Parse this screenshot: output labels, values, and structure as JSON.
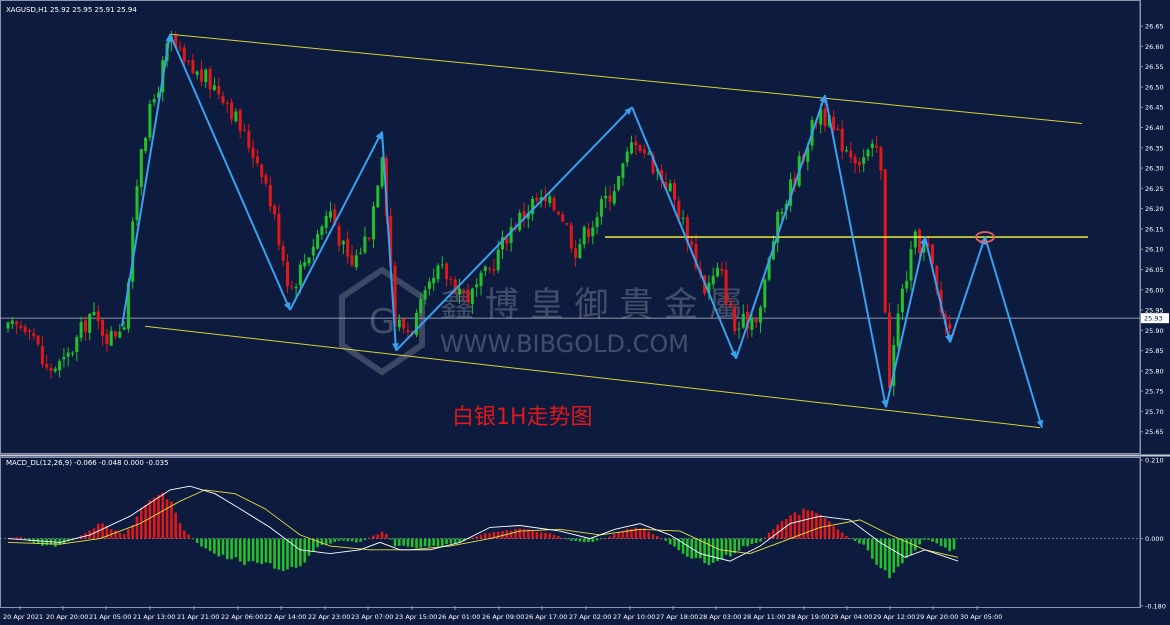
{
  "header": {
    "symbol_info": "XAGUSD,H1  25.92 25.95 25.91 25.94",
    "macd_info": "MACD_DL(12,26,9) -0.066 -0.048 0.000 -0.035"
  },
  "annotation": "白银1H走势图",
  "watermark": {
    "cn": "鑫 博 皇 御 貴 金 屬",
    "en": "WWW.BIBGOLD.COM",
    "logo": "G"
  },
  "colors": {
    "background": "#0d1b3e",
    "bull": "#22c02a",
    "bear": "#e01818",
    "zigzag": "#3aa0f0",
    "channel": "#d8d23a",
    "resistance": "#ffff30",
    "macd_line": "#ffffff",
    "signal_line": "#e8e040"
  },
  "chart_data": [
    {
      "type": "candlestick",
      "symbol": "XAGUSD",
      "timeframe": "H1",
      "ylim": [
        25.6,
        26.67
      ],
      "yticks": [
        "26.65",
        "26.60",
        "26.55",
        "26.50",
        "26.45",
        "26.40",
        "26.35",
        "26.30",
        "26.25",
        "26.20",
        "26.15",
        "26.10",
        "26.05",
        "26.00",
        "25.95",
        "25.90",
        "25.85",
        "25.80",
        "25.75",
        "25.70",
        "25.65"
      ],
      "current_price": "25.93",
      "current_price_value": 25.93,
      "xlim": [
        0,
        1140
      ],
      "xticks": [
        {
          "x": 20,
          "label": "20 Apr 2021"
        },
        {
          "x": 63,
          "label": "20 Apr 20:00"
        },
        {
          "x": 106,
          "label": "21 Apr 05:00"
        },
        {
          "x": 150,
          "label": "21 Apr 13:00"
        },
        {
          "x": 194,
          "label": "21 Apr 21:00"
        },
        {
          "x": 238,
          "label": "22 Apr 06:00"
        },
        {
          "x": 281,
          "label": "22 Apr 14:00"
        },
        {
          "x": 325,
          "label": "22 Apr 23:00"
        },
        {
          "x": 368,
          "label": "23 Apr 07:00"
        },
        {
          "x": 412,
          "label": "23 Apr 15:00"
        },
        {
          "x": 455,
          "label": "26 Apr 01:00"
        },
        {
          "x": 499,
          "label": "26 Apr 09:00"
        },
        {
          "x": 542,
          "label": "26 Apr 17:00"
        },
        {
          "x": 586,
          "label": "27 Apr 02:00"
        },
        {
          "x": 630,
          "label": "27 Apr 10:00"
        },
        {
          "x": 673,
          "label": "27 Apr 18:00"
        },
        {
          "x": 716,
          "label": "28 Apr 03:00"
        },
        {
          "x": 760,
          "label": "28 Apr 11:00"
        },
        {
          "x": 804,
          "label": "28 Apr 19:00"
        },
        {
          "x": 847,
          "label": "29 Apr 04:00"
        },
        {
          "x": 890,
          "label": "29 Apr 12:00"
        },
        {
          "x": 933,
          "label": "29 Apr 20:00"
        },
        {
          "x": 977,
          "label": "30 Apr 05:00"
        }
      ],
      "path_anchors": [
        [
          8,
          25.9
        ],
        [
          30,
          25.92
        ],
        [
          45,
          25.8
        ],
        [
          65,
          25.82
        ],
        [
          90,
          25.94
        ],
        [
          110,
          25.88
        ],
        [
          125,
          25.93
        ],
        [
          140,
          26.35
        ],
        [
          160,
          26.52
        ],
        [
          170,
          26.62
        ],
        [
          185,
          26.55
        ],
        [
          205,
          26.52
        ],
        [
          225,
          26.48
        ],
        [
          240,
          26.4
        ],
        [
          262,
          26.3
        ],
        [
          280,
          26.12
        ],
        [
          290,
          26.0
        ],
        [
          310,
          26.1
        ],
        [
          330,
          26.2
        ],
        [
          350,
          26.05
        ],
        [
          370,
          26.15
        ],
        [
          382,
          26.35
        ],
        [
          395,
          25.92
        ],
        [
          410,
          25.9
        ],
        [
          440,
          26.05
        ],
        [
          470,
          25.98
        ],
        [
          490,
          26.05
        ],
        [
          510,
          26.15
        ],
        [
          535,
          26.22
        ],
        [
          560,
          26.2
        ],
        [
          575,
          26.1
        ],
        [
          600,
          26.2
        ],
        [
          620,
          26.28
        ],
        [
          635,
          26.38
        ],
        [
          650,
          26.32
        ],
        [
          670,
          26.25
        ],
        [
          690,
          26.12
        ],
        [
          705,
          26.0
        ],
        [
          720,
          26.05
        ],
        [
          735,
          25.9
        ],
        [
          760,
          25.95
        ],
        [
          775,
          26.15
        ],
        [
          790,
          26.25
        ],
        [
          805,
          26.35
        ],
        [
          820,
          26.45
        ],
        [
          835,
          26.38
        ],
        [
          860,
          26.32
        ],
        [
          880,
          26.35
        ],
        [
          888,
          25.75
        ],
        [
          900,
          25.97
        ],
        [
          915,
          26.12
        ],
        [
          928,
          26.1
        ],
        [
          940,
          25.95
        ],
        [
          950,
          25.9
        ],
        [
          955,
          25.93
        ]
      ],
      "zigzag": [
        [
          122,
          25.91
        ],
        [
          170,
          26.63
        ],
        [
          290,
          25.95
        ],
        [
          382,
          26.39
        ],
        [
          396,
          25.85
        ],
        [
          632,
          26.45
        ],
        [
          736,
          25.83
        ],
        [
          825,
          26.48
        ],
        [
          886,
          25.71
        ],
        [
          925,
          26.13
        ],
        [
          950,
          25.87
        ],
        [
          985,
          26.13
        ],
        [
          1042,
          25.66
        ]
      ],
      "channel_upper": [
        [
          170,
          26.63
        ],
        [
          1082,
          26.41
        ]
      ],
      "channel_lower": [
        [
          145,
          25.91
        ],
        [
          1040,
          25.66
        ]
      ],
      "resistance": {
        "x0": 605,
        "x1": 1088,
        "y": 26.13
      },
      "marker": {
        "x": 985,
        "y": 26.13
      }
    },
    {
      "type": "histogram+line",
      "name": "MACD_DL(12,26,9)",
      "ylim": [
        -0.18,
        0.21
      ],
      "yticks": [
        "0.210",
        "0.000",
        "-0.180"
      ],
      "hist_anchors": [
        [
          8,
          0.0
        ],
        [
          20,
          0.005
        ],
        [
          35,
          -0.015
        ],
        [
          55,
          -0.02
        ],
        [
          72,
          -0.005
        ],
        [
          85,
          0.015
        ],
        [
          100,
          0.04
        ],
        [
          115,
          0.02
        ],
        [
          125,
          0.01
        ],
        [
          140,
          0.07
        ],
        [
          152,
          0.1
        ],
        [
          162,
          0.11
        ],
        [
          172,
          0.09
        ],
        [
          185,
          0.02
        ],
        [
          200,
          -0.02
        ],
        [
          215,
          -0.04
        ],
        [
          240,
          -0.06
        ],
        [
          260,
          -0.07
        ],
        [
          285,
          -0.08
        ],
        [
          300,
          -0.07
        ],
        [
          320,
          -0.02
        ],
        [
          340,
          -0.005
        ],
        [
          360,
          -0.01
        ],
        [
          375,
          0.01
        ],
        [
          385,
          0.02
        ],
        [
          395,
          -0.02
        ],
        [
          420,
          -0.025
        ],
        [
          440,
          -0.02
        ],
        [
          460,
          -0.01
        ],
        [
          480,
          0.01
        ],
        [
          500,
          0.02
        ],
        [
          520,
          0.025
        ],
        [
          550,
          0.015
        ],
        [
          570,
          -0.005
        ],
        [
          590,
          -0.01
        ],
        [
          610,
          0.005
        ],
        [
          630,
          0.03
        ],
        [
          645,
          0.025
        ],
        [
          665,
          -0.005
        ],
        [
          680,
          -0.03
        ],
        [
          695,
          -0.06
        ],
        [
          710,
          -0.065
        ],
        [
          725,
          -0.05
        ],
        [
          745,
          -0.02
        ],
        [
          760,
          -0.01
        ],
        [
          775,
          0.03
        ],
        [
          790,
          0.06
        ],
        [
          805,
          0.075
        ],
        [
          820,
          0.06
        ],
        [
          835,
          0.03
        ],
        [
          850,
          0.0
        ],
        [
          865,
          -0.02
        ],
        [
          880,
          -0.08
        ],
        [
          890,
          -0.1
        ],
        [
          900,
          -0.07
        ],
        [
          915,
          -0.03
        ],
        [
          925,
          0.0
        ],
        [
          935,
          -0.01
        ],
        [
          948,
          -0.03
        ],
        [
          958,
          -0.035
        ]
      ],
      "macd_line": [
        [
          8,
          0.0
        ],
        [
          60,
          -0.01
        ],
        [
          90,
          0.01
        ],
        [
          130,
          0.06
        ],
        [
          170,
          0.13
        ],
        [
          190,
          0.14
        ],
        [
          215,
          0.12
        ],
        [
          240,
          0.08
        ],
        [
          270,
          0.03
        ],
        [
          300,
          -0.03
        ],
        [
          330,
          -0.04
        ],
        [
          360,
          -0.03
        ],
        [
          380,
          -0.01
        ],
        [
          400,
          -0.03
        ],
        [
          430,
          -0.03
        ],
        [
          460,
          -0.01
        ],
        [
          490,
          0.03
        ],
        [
          520,
          0.035
        ],
        [
          560,
          0.02
        ],
        [
          590,
          0.0
        ],
        [
          615,
          0.025
        ],
        [
          640,
          0.04
        ],
        [
          670,
          0.01
        ],
        [
          700,
          -0.04
        ],
        [
          730,
          -0.06
        ],
        [
          760,
          -0.02
        ],
        [
          790,
          0.04
        ],
        [
          820,
          0.06
        ],
        [
          850,
          0.05
        ],
        [
          880,
          -0.01
        ],
        [
          905,
          -0.05
        ],
        [
          925,
          -0.03
        ],
        [
          958,
          -0.06
        ]
      ],
      "signal_line": [
        [
          8,
          -0.01
        ],
        [
          60,
          -0.015
        ],
        [
          100,
          0.0
        ],
        [
          140,
          0.04
        ],
        [
          180,
          0.1
        ],
        [
          205,
          0.13
        ],
        [
          235,
          0.12
        ],
        [
          265,
          0.08
        ],
        [
          300,
          0.01
        ],
        [
          330,
          -0.02
        ],
        [
          370,
          -0.03
        ],
        [
          410,
          -0.03
        ],
        [
          450,
          -0.02
        ],
        [
          490,
          0.0
        ],
        [
          520,
          0.02
        ],
        [
          560,
          0.025
        ],
        [
          600,
          0.01
        ],
        [
          640,
          0.025
        ],
        [
          680,
          0.02
        ],
        [
          720,
          -0.03
        ],
        [
          750,
          -0.04
        ],
        [
          780,
          -0.01
        ],
        [
          820,
          0.03
        ],
        [
          860,
          0.05
        ],
        [
          890,
          0.01
        ],
        [
          925,
          -0.03
        ],
        [
          958,
          -0.05
        ]
      ]
    }
  ]
}
